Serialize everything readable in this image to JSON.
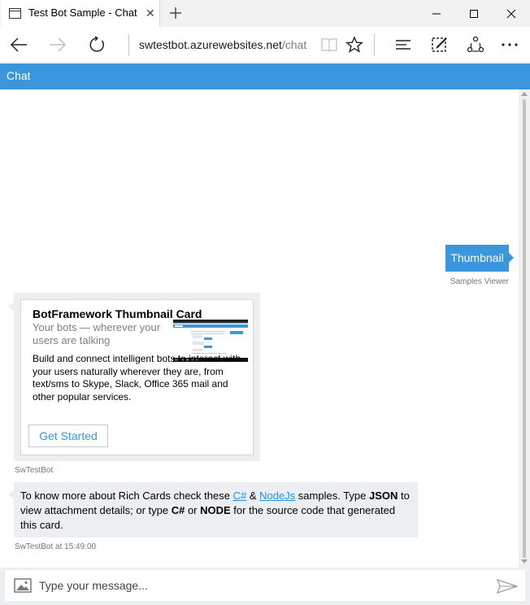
{
  "browser": {
    "tab_title": "Test Bot Sample - Chat",
    "tab_close": "✕",
    "url_host": "swtestbot.azurewebsites.net",
    "url_path": "/chat"
  },
  "chat": {
    "header_title": "Chat",
    "user_message": "Thumbnail",
    "user_meta": "Samples Viewer",
    "card": {
      "title": "BotFramework Thumbnail Card",
      "subtitle": "Your bots — wherever your users are talking",
      "text": "Build and connect intelligent bots to interact with your users naturally wherever they are, from text/sms to Skype, Slack, Office 365 mail and other popular services.",
      "button_label": "Get Started"
    },
    "card_meta": "SwTestBot",
    "bot_message": {
      "part1": "To know more about Rich Cards check these ",
      "link1": "C#",
      "part2": " & ",
      "link2": "NodeJs",
      "part3": " samples. Type ",
      "bold1": "JSON",
      "part4": " to view attachment details; or type ",
      "bold2": "C#",
      "part5": " or ",
      "bold3": "NODE",
      "part6": " for the source code that generated this card."
    },
    "bot_meta": "SwTestBot at 15:49:00",
    "input_placeholder": "Type your message..."
  },
  "colors": {
    "accent": "#3a96dd",
    "bubble_bg": "#eceff1",
    "link": "#1e90e0"
  },
  "icons": [
    "page-icon",
    "plus-icon",
    "minimize-icon",
    "maximize-icon",
    "close-icon",
    "back-arrow-icon",
    "forward-arrow-icon",
    "refresh-icon",
    "reading-view-icon",
    "star-icon",
    "hub-icon",
    "web-note-icon",
    "share-icon",
    "more-icon",
    "image-upload-icon",
    "send-icon"
  ]
}
